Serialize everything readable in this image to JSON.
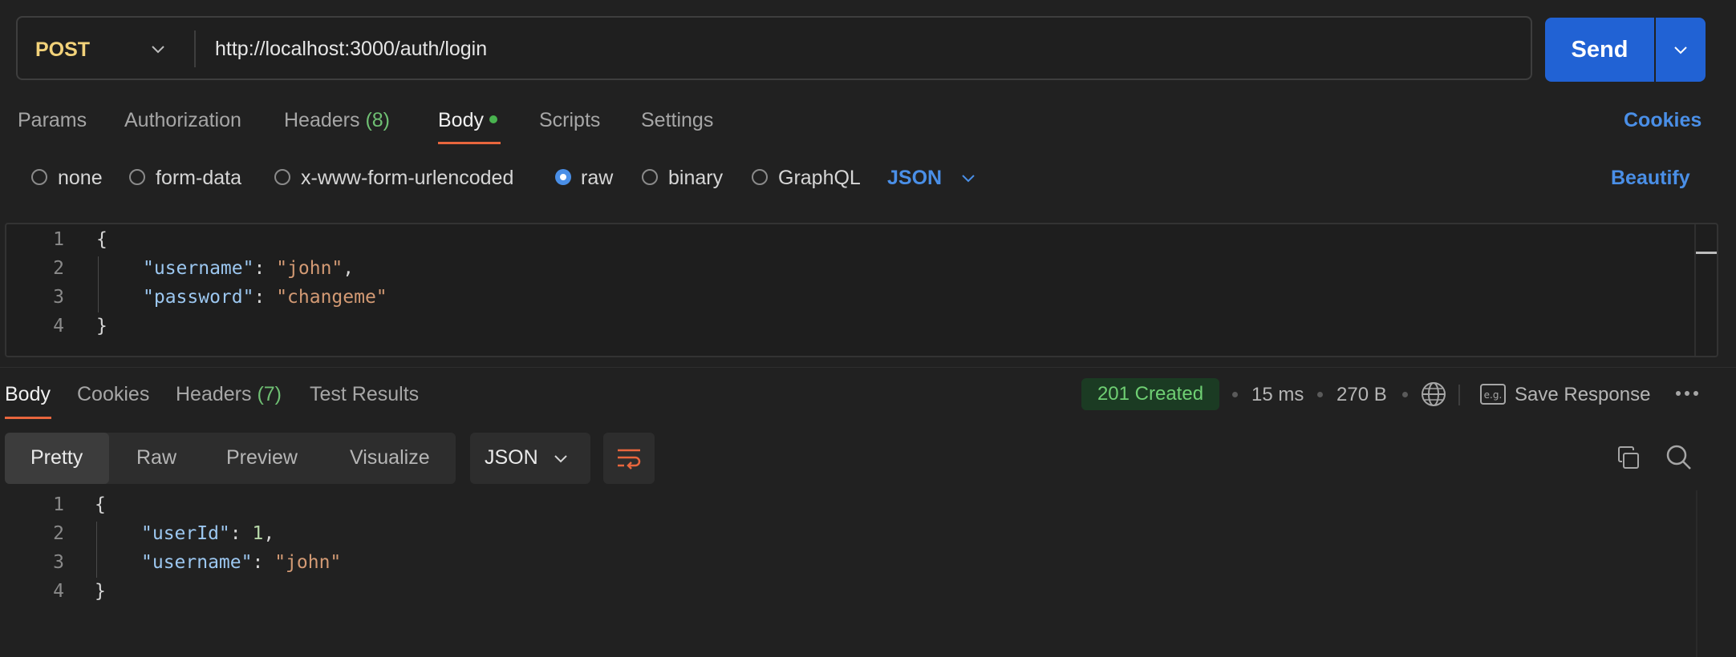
{
  "request": {
    "method": "POST",
    "url": "http://localhost:3000/auth/login",
    "send_label": "Send"
  },
  "request_tabs": [
    {
      "label": "Params"
    },
    {
      "label": "Authorization"
    },
    {
      "label": "Headers",
      "count": "(8)"
    },
    {
      "label": "Body",
      "active": true
    },
    {
      "label": "Scripts"
    },
    {
      "label": "Settings"
    }
  ],
  "cookies_link": "Cookies",
  "body_types": [
    {
      "label": "none",
      "selected": false
    },
    {
      "label": "form-data",
      "selected": false
    },
    {
      "label": "x-www-form-urlencoded",
      "selected": false
    },
    {
      "label": "raw",
      "selected": true
    },
    {
      "label": "binary",
      "selected": false
    },
    {
      "label": "GraphQL",
      "selected": false
    }
  ],
  "raw_format": "JSON",
  "beautify_label": "Beautify",
  "request_body": {
    "line_numbers": [
      "1",
      "2",
      "3",
      "4"
    ],
    "open_brace": "{",
    "close_brace": "}",
    "fields": [
      {
        "key": "\"username\"",
        "value": "\"john\"",
        "trail": ","
      },
      {
        "key": "\"password\"",
        "value": "\"changeme\"",
        "trail": ""
      }
    ]
  },
  "response_tabs": [
    {
      "label": "Body",
      "active": true
    },
    {
      "label": "Cookies"
    },
    {
      "label": "Headers",
      "count": "(7)"
    },
    {
      "label": "Test Results"
    }
  ],
  "response_meta": {
    "status": "201 Created",
    "time": "15 ms",
    "size": "270 B",
    "save_label": "Save Response",
    "status_color": "#6fcf73"
  },
  "view_modes": [
    {
      "label": "Pretty",
      "active": true
    },
    {
      "label": "Raw"
    },
    {
      "label": "Preview"
    },
    {
      "label": "Visualize"
    }
  ],
  "response_format": "JSON",
  "response_body": {
    "line_numbers": [
      "1",
      "2",
      "3",
      "4"
    ],
    "open_brace": "{",
    "close_brace": "}",
    "fields": [
      {
        "key": "\"userId\"",
        "value": "1",
        "trail": ","
      },
      {
        "key": "\"username\"",
        "value": "\"john\"",
        "trail": ""
      }
    ]
  },
  "icons": {
    "globe": "globe-icon",
    "eg": "example-icon",
    "more": "more-options-icon",
    "copy": "copy-icon",
    "search": "search-icon",
    "wrap": "wrap-lines-icon"
  },
  "colors": {
    "accent": "#2162d4",
    "method": "#f2d27a",
    "tab_underline": "#e8663d",
    "link": "#4a8fe7"
  }
}
